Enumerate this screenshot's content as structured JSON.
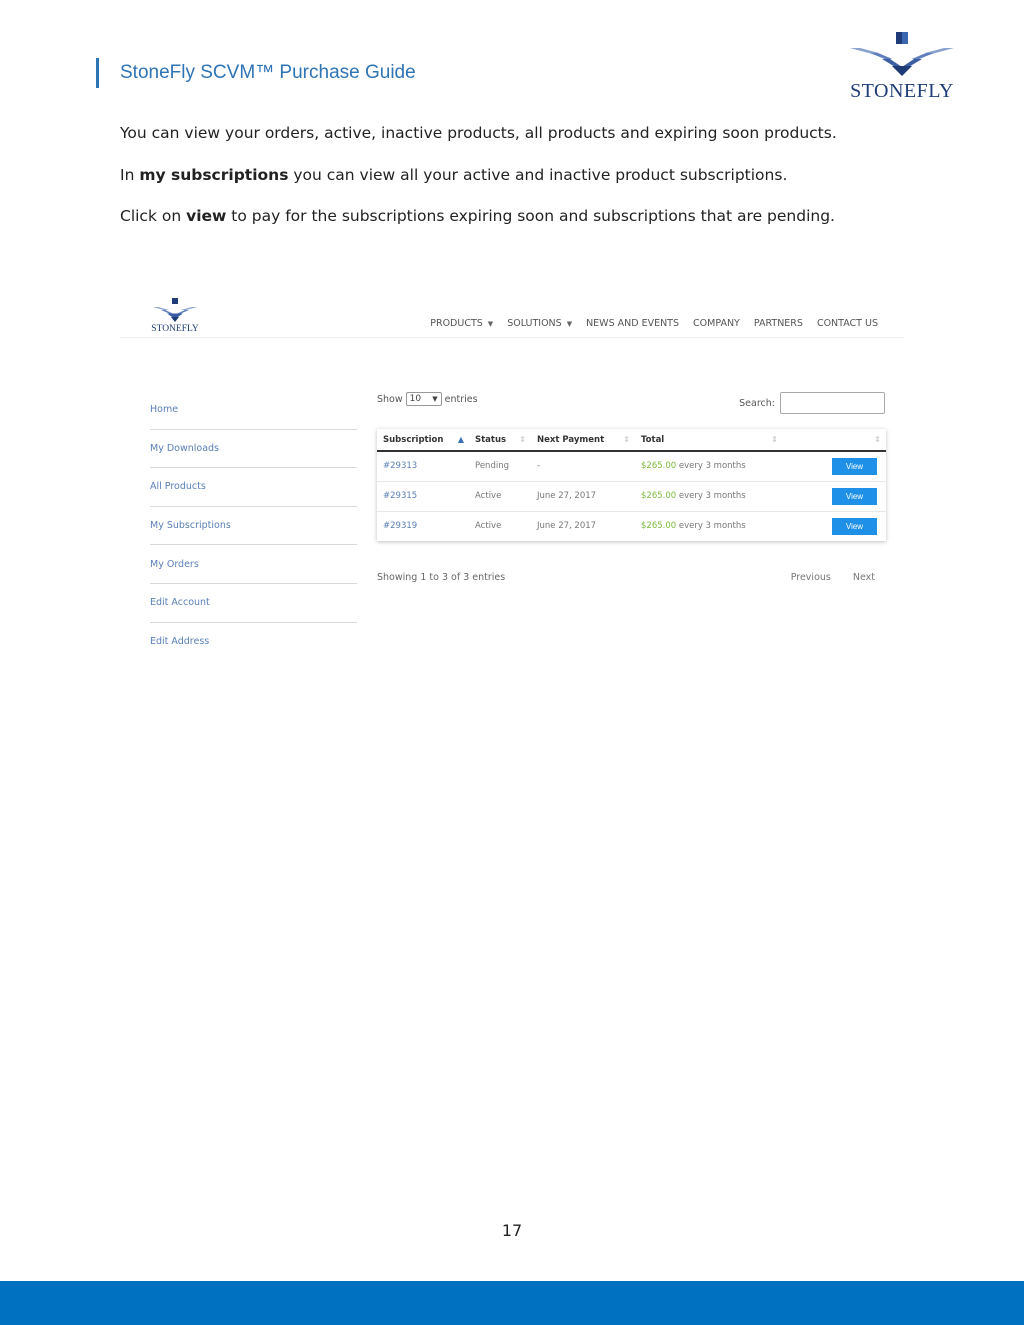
{
  "document": {
    "title": "StoneFly SCVM™ Purchase Guide",
    "logo_text": "STONEFLY",
    "paragraph1": "You can view your orders, active, inactive products, all products and expiring soon products.",
    "paragraph2": {
      "prefix": "In ",
      "bold": "my subscriptions",
      "suffix": " you can view all your active and inactive product subscriptions."
    },
    "paragraph3": {
      "prefix": "Click on ",
      "bold": "view",
      "suffix": " to pay for the subscriptions expiring soon and subscriptions that are pending."
    },
    "page_number": "17"
  },
  "site": {
    "logo_text": "STONEFLY",
    "nav": [
      {
        "label": "PRODUCTS",
        "dropdown": true
      },
      {
        "label": "SOLUTIONS",
        "dropdown": true
      },
      {
        "label": "NEWS AND EVENTS",
        "dropdown": false
      },
      {
        "label": "COMPANY",
        "dropdown": false
      },
      {
        "label": "PARTNERS",
        "dropdown": false
      },
      {
        "label": "CONTACT US",
        "dropdown": false
      }
    ],
    "sidebar": [
      "Home",
      "My Downloads",
      "All Products",
      "My Subscriptions",
      "My Orders",
      "Edit Account",
      "Edit Address"
    ],
    "table_controls": {
      "show_label": "Show",
      "entries_value": "10",
      "entries_label": "entries",
      "search_label": "Search:",
      "search_value": ""
    },
    "table": {
      "headers": [
        "Subscription",
        "Status",
        "Next Payment",
        "Total",
        ""
      ],
      "rows": [
        {
          "id": "#29313",
          "status": "Pending",
          "next_payment": "-",
          "price": "$265.00",
          "period": " every 3 months",
          "action": "View"
        },
        {
          "id": "#29315",
          "status": "Active",
          "next_payment": "June 27, 2017",
          "price": "$265.00",
          "period": " every 3 months",
          "action": "View"
        },
        {
          "id": "#29319",
          "status": "Active",
          "next_payment": "June 27, 2017",
          "price": "$265.00",
          "period": " every 3 months",
          "action": "View"
        }
      ]
    },
    "showing_text": "Showing 1 to 3 of 3 entries",
    "pager": {
      "previous": "Previous",
      "next": "Next"
    }
  },
  "colors": {
    "doc_title": "#2e74b5",
    "footer_bar": "#0070c0",
    "link": "#5a80b8",
    "price": "#7cba3d",
    "view_button": "#1e90e8"
  }
}
